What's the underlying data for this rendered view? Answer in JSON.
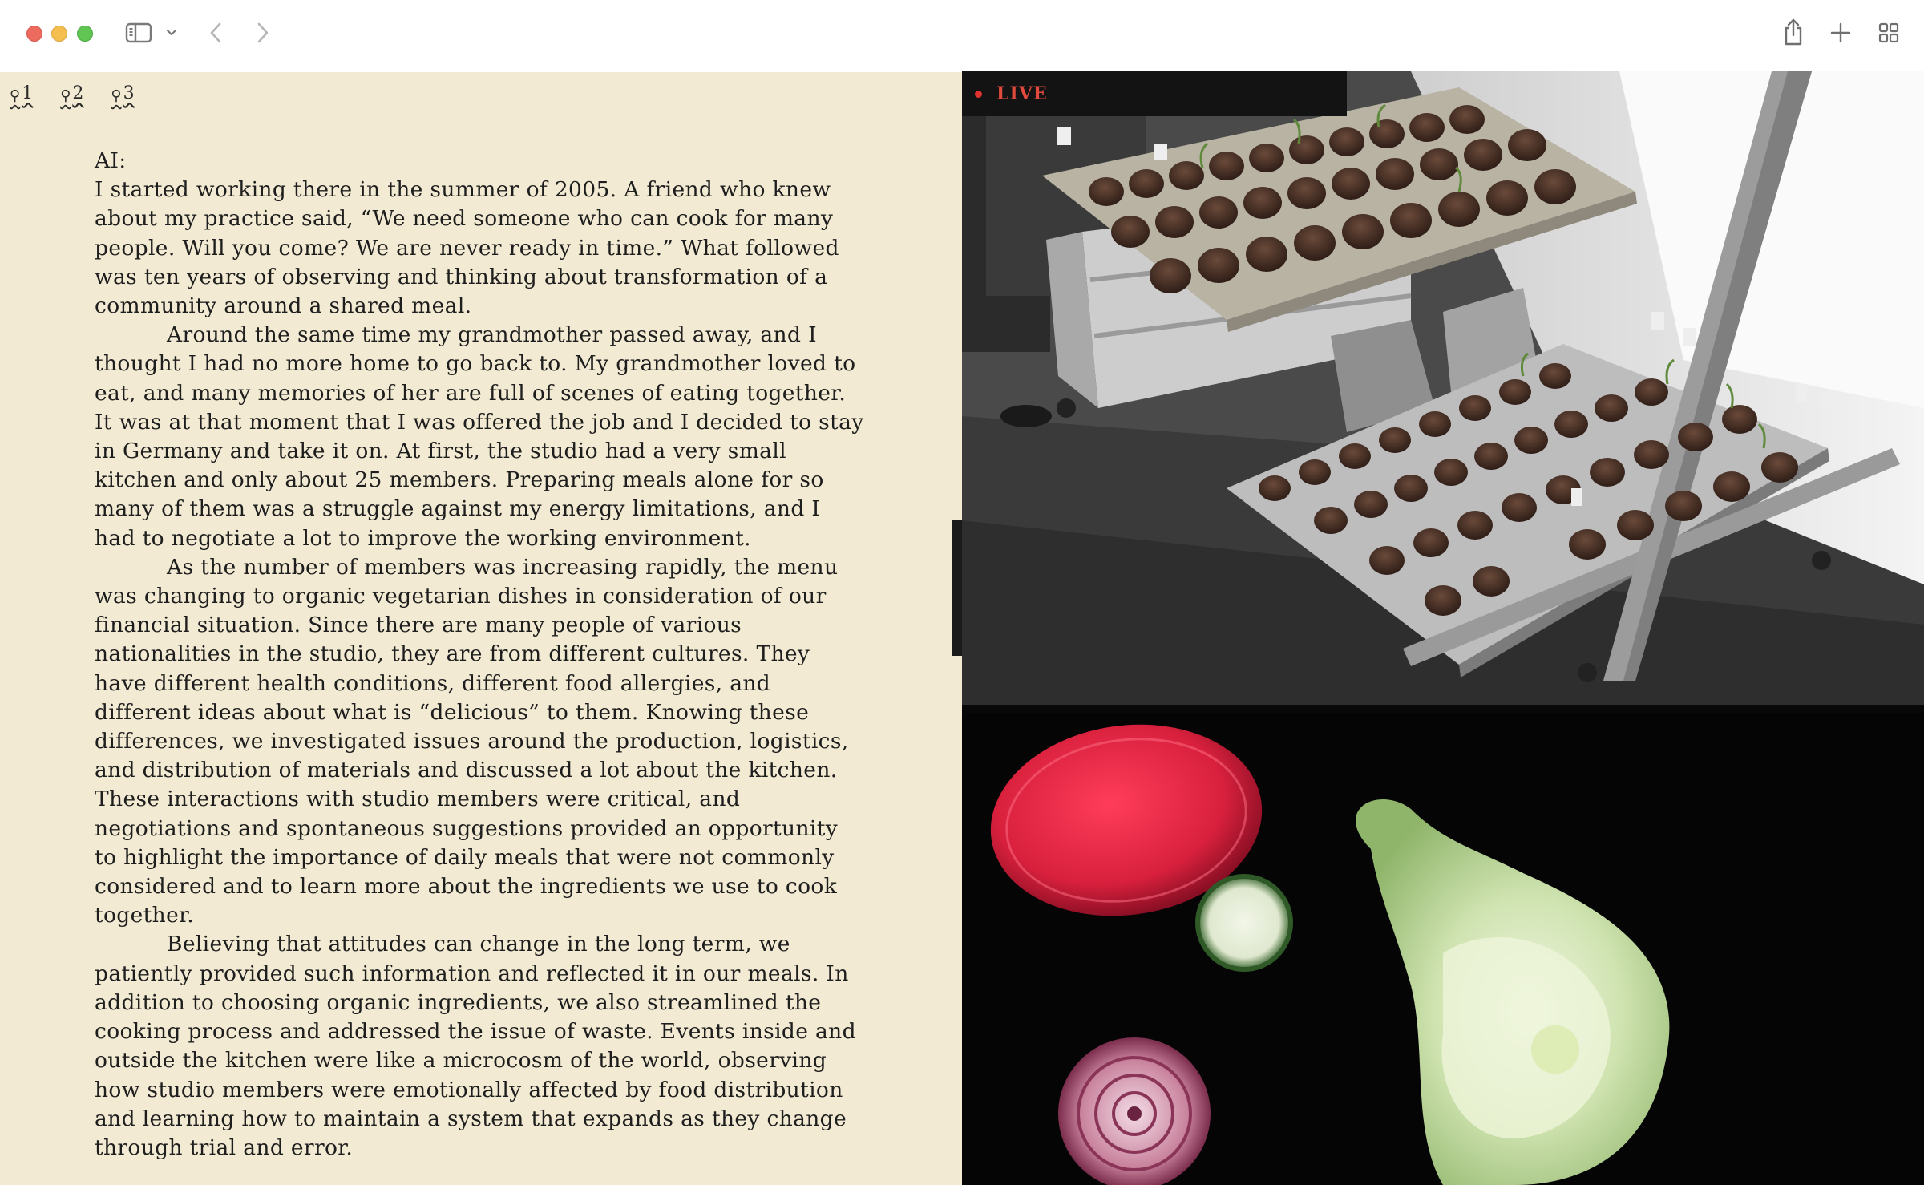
{
  "pagination": {
    "pages": [
      {
        "label": "1"
      },
      {
        "label": "2"
      },
      {
        "label": "3"
      }
    ]
  },
  "article": {
    "speaker": "AI:",
    "paragraphs": [
      "I started working there in the summer of 2005. A friend who knew about my practice said, “We need someone who can cook for many people. Will you come? We are never ready in time.” What followed was ten years of observing and thinking about transformation of a community around a shared meal.",
      "Around the same time my grandmother passed away, and I thought I had no more home to go back to. My grandmother loved to eat, and many memories of her are full of scenes of eating together. It was at that moment that I was offered the job and I decided to stay in Germany and take it on. At first, the studio had a very small kitchen and only about 25 members. Preparing meals alone for so many of them was a struggle against my energy limitations, and I had to negotiate a lot to improve the working environment.",
      "As the number of members was increasing rapidly, the menu was changing to organic vegetarian dishes in consideration of our financial situation. Since there are many people of various nationalities in the studio, they are from different cultures. They have different health conditions, different food allergies, and different ideas about what is “delicious” to them. Knowing these differences, we investigated issues around the production, logistics, and distribution of materials and discussed a lot about the kitchen. These interactions with studio members were critical, and negotiations and spontaneous suggestions provided an opportunity to highlight the importance of daily meals that were not commonly considered and to learn more about the ingredients we use to cook together.",
      "Believing that attitudes can change in the long term, we patiently provided such information and reflected it in our meals. In addition to choosing organic ingredients, we also streamlined the cooking process and addressed the issue of waste. Events inside and outside the kitchen were like a microcosm of the world, observing how studio members were emotionally affected by food distribution and learning how to maintain a system that expands as they change through trial and error."
    ]
  },
  "media": {
    "live_label": "LIVE",
    "live_color": "#e24a3e"
  },
  "colors": {
    "paper": "#f2ead2",
    "ink": "#1e1e1e",
    "media_bg": "#080808"
  },
  "icons": {
    "sidebar": "sidebar-icon",
    "back": "chevron-left-icon",
    "forward": "chevron-right-icon",
    "share": "share-icon",
    "new_tab": "plus-icon",
    "tabs_overview": "tab-grid-icon",
    "page": "reader-icon"
  }
}
